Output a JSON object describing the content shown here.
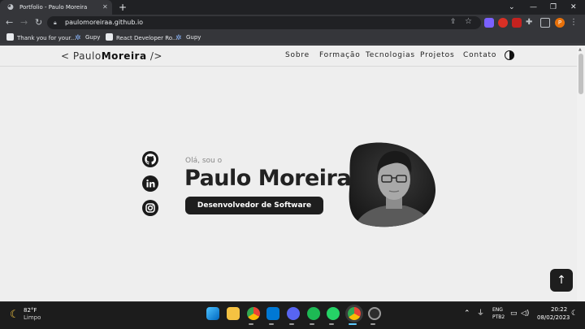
{
  "browser": {
    "tab_title": "Portfolio - Paulo Moreira",
    "tab_close": "✕",
    "new_tab": "+",
    "url": "paulomoreiraa.github.io",
    "profile_initial": "P",
    "window": {
      "minimize": "⌄",
      "restore": "—",
      "maximize": "❐",
      "close": "✕"
    },
    "bookmarks": [
      {
        "label": "Thank you for your..."
      },
      {
        "label": "Gupy"
      },
      {
        "label": "React Developer Ro..."
      },
      {
        "label": "Gupy"
      }
    ]
  },
  "site": {
    "logo_open": "< Paulo",
    "logo_bold": "Moreira",
    "logo_close": " />",
    "nav": [
      "Sobre",
      "Formação",
      "Tecnologias",
      "Projetos",
      "Contato"
    ],
    "greeting": "Olá, sou o",
    "name": "Paulo Moreira",
    "role": "Desenvolvedor de Software",
    "social": [
      "github-icon",
      "linkedin-icon",
      "instagram-icon"
    ],
    "back_to_top": "↑"
  },
  "taskbar": {
    "temperature": "82°F",
    "condition": "Limpo",
    "lang_line1": "ENG",
    "lang_line2": "PTB2",
    "time": "20:22",
    "date": "08/02/2023"
  },
  "colors": {
    "accent_dark": "#1e1e1e",
    "page_bg": "#eeeeee",
    "chrome_dark": "#202124"
  }
}
